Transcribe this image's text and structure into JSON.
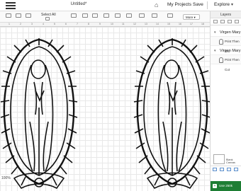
{
  "header": {
    "title": "Untitled*",
    "my_projects": "My Projects",
    "save": "Save",
    "explore": "Explore"
  },
  "toolbar": {
    "select_all": "Select All",
    "more": "More"
  },
  "ruler": {
    "marks": [
      "1",
      "2",
      "3",
      "4",
      "5",
      "6",
      "7",
      "8",
      "9",
      "10",
      "11",
      "12",
      "13",
      "14",
      "15",
      "16",
      "17",
      "18"
    ]
  },
  "canvas": {
    "zoom": "100%"
  },
  "layers_panel": {
    "title": "Layers",
    "groups": [
      {
        "name": "Virgen Mary",
        "layer": "Print Then Cut"
      },
      {
        "name": "Virgen Mary",
        "layer": "Print Then Cut"
      }
    ],
    "blank_canvas": "Blank Canvas",
    "promo": "Use 250k"
  },
  "colors": {
    "promo_green": "#1e7e34",
    "grid": "#e8e8e8",
    "line": "#111111"
  }
}
